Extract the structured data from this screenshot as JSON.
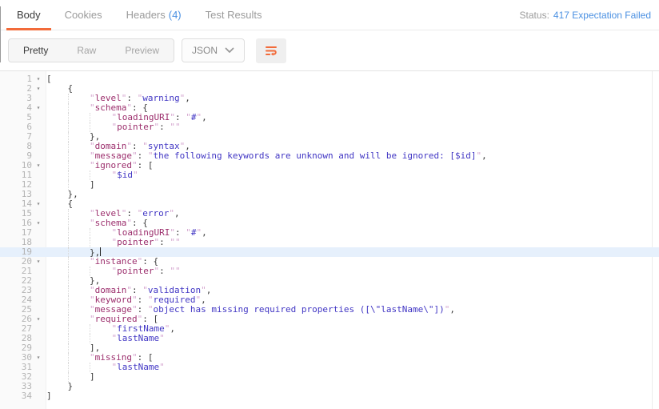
{
  "tabs": {
    "items": [
      {
        "label": "Body",
        "active": true
      },
      {
        "label": "Cookies",
        "active": false
      },
      {
        "label": "Headers",
        "count": "(4)",
        "active": false
      },
      {
        "label": "Test Results",
        "active": false
      }
    ]
  },
  "status": {
    "label": "Status:",
    "value": "417 Expectation Failed"
  },
  "toolbar": {
    "views": [
      "Pretty",
      "Raw",
      "Preview"
    ],
    "active_view": "Pretty",
    "format": "JSON",
    "icons": {
      "format_dropdown": "chevron-down-icon",
      "wrap": "wrap-lines-icon"
    }
  },
  "colors": {
    "accent": "#f26b3a",
    "link": "#4a90e2",
    "json_key": "#9c2f6d",
    "json_string": "#4136c4",
    "json_quote": "#d5a6cf",
    "active_line_bg": "#e6f0fc"
  },
  "editor": {
    "active_line": 19,
    "fold_lines": [
      1,
      2,
      4,
      10,
      14,
      16,
      20,
      26,
      30
    ],
    "lines": [
      "[",
      "    {",
      "        \"level\": \"warning\",",
      "        \"schema\": {",
      "            \"loadingURI\": \"#\",",
      "            \"pointer\": \"\"",
      "        },",
      "        \"domain\": \"syntax\",",
      "        \"message\": \"the following keywords are unknown and will be ignored: [$id]\",",
      "        \"ignored\": [",
      "            \"$id\"",
      "        ]",
      "    },",
      "    {",
      "        \"level\": \"error\",",
      "        \"schema\": {",
      "            \"loadingURI\": \"#\",",
      "            \"pointer\": \"\"",
      "        },",
      "        \"instance\": {",
      "            \"pointer\": \"\"",
      "        },",
      "        \"domain\": \"validation\",",
      "        \"keyword\": \"required\",",
      "        \"message\": \"object has missing required properties ([\\\"lastName\\\"])\",",
      "        \"required\": [",
      "            \"firstName\",",
      "            \"lastName\"",
      "        ],",
      "        \"missing\": [",
      "            \"lastName\"",
      "        ]",
      "    }",
      "]"
    ]
  }
}
